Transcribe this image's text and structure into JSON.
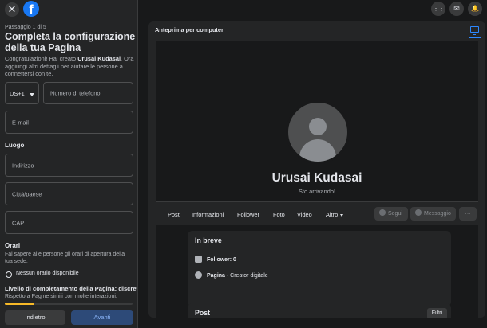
{
  "app": {
    "close_glyph": "✕",
    "logo_letter": "f",
    "brand_color": "#1877f2"
  },
  "setup": {
    "step": "Passaggio 1 di 5",
    "title": "Completa la configurazione della tua Pagina",
    "intro_prefix": "Congratulazioni! Hai creato ",
    "page_name": "Urusai Kudasai",
    "intro_suffix": ". Ora aggiungi altri dettagli per aiutare le persone a connettersi con te.",
    "country_code": "US+1",
    "phone_placeholder": "Numero di telefono",
    "email_placeholder": "E-mail",
    "location_heading": "Luogo",
    "address_placeholder": "Indirizzo",
    "city_placeholder": "Città/paese",
    "zip_placeholder": "CAP",
    "hours_heading": "Orari",
    "hours_description": "Fai sapere alle persone gli orari di apertura della tua sede.",
    "no_hours_option": "Nessun orario disponibile",
    "completion_title": "Livello di completamento della Pagina: discreto",
    "completion_description": "Rispetto a Pagine simili con molte interazioni.",
    "completion_progress": 0.23,
    "progress_color": "#f7b928",
    "back_button": "Indietro",
    "next_button": "Avanti"
  },
  "header_icons": [
    {
      "name": "menu-grid-icon",
      "glyph": "⋮⋮"
    },
    {
      "name": "messenger-icon",
      "glyph": "✉"
    },
    {
      "name": "notifications-icon",
      "glyph": "🔔"
    }
  ],
  "preview": {
    "label": "Anteprima per computer",
    "page_name": "Urusai Kudasai",
    "subtitle": "Sto arrivando!",
    "tabs": [
      "Post",
      "Informazioni",
      "Follower",
      "Foto",
      "Video",
      "Altro"
    ],
    "follow_button": "Segui",
    "message_button": "Messaggio",
    "more_button": "···",
    "about_card": {
      "title": "In breve",
      "followers": "Follower: 0",
      "category_bold": "Pagina",
      "category_rest": " · Creator digitale"
    },
    "posts_card": {
      "title": "Post",
      "filters_button": "Filtri"
    }
  }
}
